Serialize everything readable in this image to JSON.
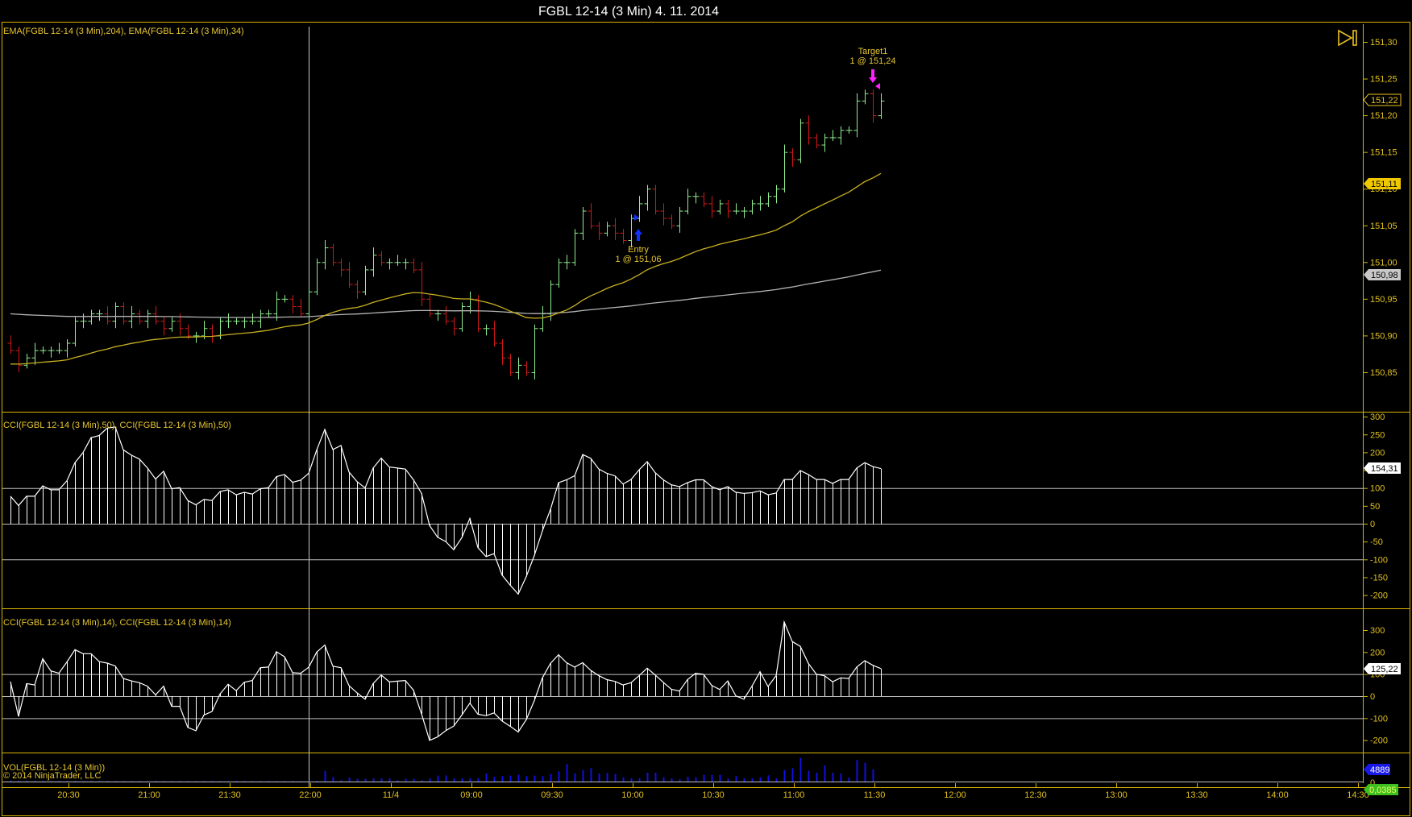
{
  "window": {
    "title": "FGBL 12-14 (3 Min)  4. 11. 2014"
  },
  "colors": {
    "panel_border": "#d8b400",
    "up_bar": "#90ee90",
    "down_bar": "#d01818",
    "ema34": "#c8b020",
    "ema204": "#b4b4b4",
    "cci": "#ffffff",
    "volume": "#1010e0",
    "entry": "#1030ff",
    "target": "#ff20ff",
    "axis_text": "#e0c020"
  },
  "toolbar": {
    "scroll_to_end_icon": "play-end-icon"
  },
  "panels": {
    "price": {
      "label": "EMA(FGBL 12-14 (3 Min),204), EMA(FGBL 12-14 (3 Min),34)",
      "ticks": [
        "151,30",
        "151,25",
        "151,20",
        "151,15",
        "151,10",
        "151,05",
        "151,00",
        "150,95",
        "150,90",
        "150,85"
      ],
      "last_price_tag": "151,22",
      "ema34_tag": "151,11",
      "ema204_tag": "150,98"
    },
    "cci50": {
      "label": "CCI(FGBL 12-14 (3 Min),50), CCI(FGBL 12-14 (3 Min),50)",
      "ticks": [
        "300",
        "250",
        "200",
        "150",
        "100",
        "50",
        "0",
        "-50",
        "-100",
        "-150",
        "-200"
      ],
      "value_tag": "154,31"
    },
    "cci14": {
      "label": "CCI(FGBL 12-14 (3 Min),14), CCI(FGBL 12-14 (3 Min),14)",
      "ticks": [
        "300",
        "200",
        "100",
        "0",
        "-100",
        "-200"
      ],
      "value_tag": "125,22"
    },
    "volume": {
      "label": "VOL(FGBL 12-14 (3 Min))",
      "copyright": "© 2014 NinjaTrader, LLC",
      "value_tag": "4889",
      "zero_tick": "0",
      "extra_tag": "0,0385"
    }
  },
  "time_axis": [
    "20:30",
    "21:00",
    "21:30",
    "22:00",
    "11/4",
    "09:00",
    "09:30",
    "10:00",
    "10:30",
    "11:00",
    "11:30",
    "12:00",
    "12:30",
    "13:00",
    "13:30",
    "14:00",
    "14:30"
  ],
  "annotations": {
    "entry": {
      "label": "Entry",
      "detail": "1 @ 151,06",
      "price": 151.06
    },
    "target": {
      "label": "Target1",
      "detail": "1 @ 151,24",
      "price": 151.24
    }
  },
  "chart_data": [
    {
      "type": "ohlc-bar",
      "title": "FGBL 12-14 (3 Min)",
      "ylim": [
        150.83,
        151.31
      ],
      "close": [
        150.88,
        150.86,
        150.87,
        150.88,
        150.88,
        150.88,
        150.88,
        150.89,
        150.92,
        150.92,
        150.93,
        150.93,
        150.92,
        150.94,
        150.92,
        150.93,
        150.92,
        150.93,
        150.92,
        150.91,
        150.92,
        150.91,
        150.9,
        150.9,
        150.91,
        150.9,
        150.92,
        150.92,
        150.92,
        150.92,
        150.92,
        150.93,
        150.93,
        150.95,
        150.95,
        150.94,
        150.93,
        150.96,
        151.0,
        151.02,
        151.0,
        150.99,
        150.97,
        150.96,
        150.99,
        151.01,
        151.0,
        151.0,
        151.0,
        151.0,
        150.99,
        150.95,
        150.93,
        150.93,
        150.92,
        150.91,
        150.94,
        150.95,
        150.91,
        150.91,
        150.89,
        150.87,
        150.85,
        150.86,
        150.85,
        150.91,
        150.93,
        150.97,
        151.0,
        151.0,
        151.04,
        151.07,
        151.05,
        151.04,
        151.05,
        151.04,
        151.03,
        151.06,
        151.08,
        151.1,
        151.07,
        151.06,
        151.05,
        151.07,
        151.09,
        151.09,
        151.08,
        151.07,
        151.08,
        151.07,
        151.07,
        151.07,
        151.08,
        151.08,
        151.09,
        151.1,
        151.15,
        151.14,
        151.19,
        151.17,
        151.16,
        151.17,
        151.17,
        151.18,
        151.18,
        151.22,
        151.23,
        151.2,
        151.22
      ],
      "series": [
        {
          "name": "EMA(FGBL 12-14 (3 Min),34)",
          "last": 151.11
        },
        {
          "name": "EMA(FGBL 12-14 (3 Min),204)",
          "last": 150.98
        }
      ]
    },
    {
      "type": "bar",
      "title": "CCI(FGBL 12-14 (3 Min),50)",
      "ylim": [
        -230,
        310
      ],
      "reference_lines": [
        100,
        0,
        -100
      ],
      "values": [
        77,
        51,
        77,
        77,
        106,
        95,
        95,
        120,
        171,
        199,
        241,
        247,
        268,
        271,
        207,
        192,
        181,
        156,
        125,
        147,
        98,
        101,
        65,
        53,
        68,
        65,
        90,
        95,
        81,
        88,
        83,
        98,
        101,
        132,
        138,
        116,
        122,
        141,
        207,
        264,
        208,
        219,
        145,
        118,
        100,
        156,
        184,
        159,
        156,
        153,
        123,
        85,
        -5,
        -38,
        -50,
        -73,
        -39,
        15,
        -67,
        -92,
        -84,
        -144,
        -172,
        -197,
        -148,
        -89,
        -20,
        40,
        115,
        123,
        134,
        194,
        183,
        153,
        141,
        134,
        111,
        124,
        151,
        174,
        143,
        123,
        109,
        104,
        115,
        123,
        123,
        104,
        95,
        104,
        88,
        85,
        87,
        92,
        81,
        86,
        124,
        124,
        149,
        138,
        124,
        124,
        113,
        124,
        124,
        156,
        171,
        160,
        154.31
      ]
    },
    {
      "type": "bar",
      "title": "CCI(FGBL 12-14 (3 Min),14)",
      "ylim": [
        -260,
        380
      ],
      "reference_lines": [
        100,
        0,
        -100
      ],
      "values": [
        65,
        -92,
        57,
        51,
        170,
        115,
        104,
        155,
        211,
        193,
        193,
        157,
        150,
        137,
        80,
        69,
        61,
        45,
        6,
        45,
        -46,
        -46,
        -142,
        -157,
        -86,
        -70,
        10,
        54,
        25,
        63,
        71,
        129,
        132,
        202,
        179,
        107,
        104,
        131,
        200,
        232,
        136,
        129,
        48,
        15,
        -14,
        57,
        96,
        65,
        68,
        71,
        27,
        -80,
        -201,
        -185,
        -157,
        -136,
        -86,
        -32,
        -82,
        -89,
        -76,
        -113,
        -137,
        -163,
        -107,
        -20,
        83,
        149,
        188,
        152,
        132,
        152,
        117,
        93,
        75,
        67,
        51,
        61,
        93,
        127,
        96,
        63,
        31,
        23,
        75,
        104,
        99,
        49,
        30,
        69,
        1,
        -14,
        45,
        111,
        44,
        93,
        337,
        248,
        226,
        149,
        99,
        93,
        65,
        83,
        80,
        132,
        161,
        140,
        125.22
      ]
    },
    {
      "type": "bar",
      "title": "VOL(FGBL 12-14 (3 Min))",
      "values": [
        400,
        300,
        300,
        300,
        300,
        250,
        300,
        300,
        300,
        250,
        300,
        250,
        300,
        300,
        300,
        200,
        300,
        200,
        300,
        300,
        250,
        300,
        200,
        250,
        300,
        300,
        250,
        200,
        300,
        300,
        200,
        250,
        300,
        200,
        250,
        300,
        200,
        300,
        300,
        4300,
        1850,
        550,
        1600,
        1100,
        1100,
        1300,
        1300,
        1300,
        550,
        1100,
        1100,
        550,
        1300,
        2400,
        2500,
        1300,
        1300,
        1300,
        1300,
        3260,
        1950,
        2200,
        2400,
        2700,
        2200,
        2400,
        2200,
        3050,
        4100,
        7060,
        3260,
        4670,
        5430,
        3260,
        3480,
        3050,
        1740,
        1300,
        1300,
        3580,
        3580,
        1740,
        1300,
        870,
        1950,
        1740,
        2700,
        2700,
        2700,
        1100,
        2200,
        1300,
        1300,
        1740,
        2500,
        1300,
        4670,
        5430,
        9560,
        4350,
        3580,
        6520,
        3580,
        3260,
        1630,
        8690,
        7600,
        4889
      ]
    }
  ]
}
